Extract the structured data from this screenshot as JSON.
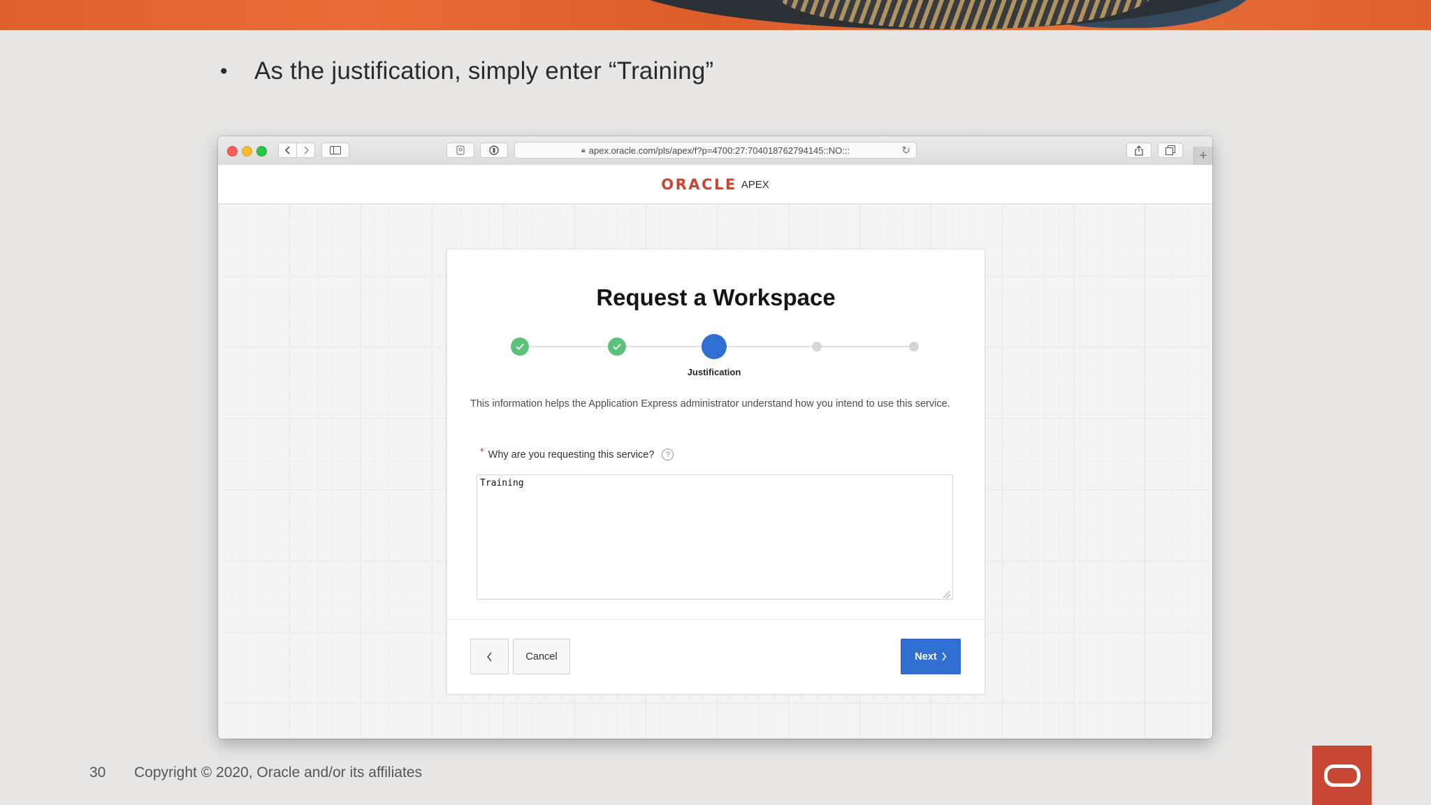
{
  "slide": {
    "bullet_symbol": "•",
    "bullet_text": "As the justification, simply enter “Training”",
    "page_number": "30",
    "copyright": "Copyright © 2020, Oracle and/or its affiliates"
  },
  "browser": {
    "url": "apex.oracle.com/pls/apex/f?p=4700:27:704018762794145::NO:::",
    "icons": [
      "back-icon",
      "forward-icon",
      "sidebar-icon",
      "privacy-icon",
      "tracker-icon",
      "lock-icon",
      "reload-icon",
      "share-icon",
      "tabs-icon",
      "new-tab-icon"
    ]
  },
  "app": {
    "brand_oracle": "ORACLE",
    "brand_apex": "APEX"
  },
  "wizard": {
    "title": "Request a Workspace",
    "steps": [
      {
        "state": "done",
        "label": ""
      },
      {
        "state": "done",
        "label": ""
      },
      {
        "state": "current",
        "label": "Justification"
      },
      {
        "state": "future",
        "label": ""
      },
      {
        "state": "future",
        "label": ""
      }
    ],
    "help_text": "This information helps the Application Express administrator understand how you intend to use this service.",
    "field": {
      "required_marker": "*",
      "label": "Why are you requesting this service?",
      "help_symbol": "?",
      "value": "Training"
    },
    "buttons": {
      "previous_symbol": "‹",
      "cancel": "Cancel",
      "next": "Next",
      "next_chevron": "›"
    }
  },
  "colors": {
    "oracle_red": "#c74634",
    "primary_blue": "#2f6fd1",
    "step_done_green": "#5cc17a",
    "required_red": "#d63b25"
  }
}
